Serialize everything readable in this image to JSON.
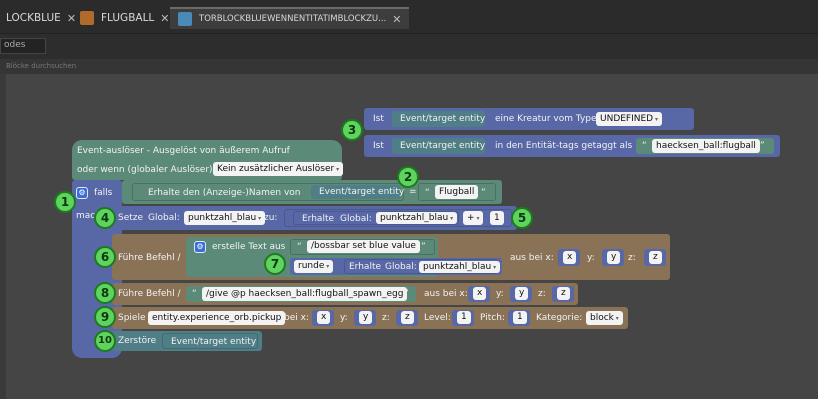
{
  "tabs": [
    {
      "label": "LOCKBLUE",
      "active": false
    },
    {
      "label": "FLUGBALL",
      "active": false
    },
    {
      "label": "TORBLOCKBLUEWENNENTITATIMBLOCKZU...",
      "active": true
    }
  ],
  "tab_close": "✕",
  "mode_field": "odes",
  "search_placeholder": "Blöcke durchsuchen",
  "colors": {
    "trigger": "#5c8a78",
    "teal": "#4f7e86",
    "var": "#5867a5",
    "purple": "#6b5aa8",
    "brown": "#8a7256",
    "green_num": "#5fd35f",
    "text_pill": "#f3f3f3"
  },
  "conditions": {
    "row1": {
      "ist": "Ist",
      "entity": "Event/target entity",
      "text": "eine Kreatur vom Type",
      "type_value": "UNDEFINED"
    },
    "row2": {
      "ist": "Ist",
      "entity": "Event/target entity",
      "text": "in den Entität-tags getaggt als",
      "quote_open": "“",
      "tag": "haecksen_ball:flugball",
      "quote_close": "”"
    }
  },
  "trigger": {
    "line1": "Event-auslöser - Ausgelöst von äußerem Aufruf",
    "line2_prefix": "oder wenn (globaler Auslöser):",
    "global_trigger": "Kein zusätzlicher Auslöser"
  },
  "if_block": {
    "falls": "falls",
    "mache": "mache",
    "get_name": "Erhalte den (Anzeige-)Namen von",
    "entity": "Event/target entity",
    "equals": "=",
    "string": "Flugball"
  },
  "set_block": {
    "setze": "Setze",
    "global_label": "Global:",
    "var_name": "punktzahl_blau",
    "zu": "zu:",
    "erhalte": "Erhalte",
    "erhalte_global": "Global:",
    "erhalte_var": "punktzahl_blau",
    "op": "+",
    "value": "1"
  },
  "cmd1": {
    "label": "Führe Befehl /",
    "create_text": "erstelle Text aus",
    "string1": "/bossbar set blue value",
    "round": "runde",
    "erhalte": "Erhalte",
    "erhalte_global": "Global:",
    "var": "punktzahl_blau",
    "at_x": "aus bei x:",
    "x": "x",
    "y_label": "y:",
    "y": "y",
    "z_label": "z:",
    "z": "z"
  },
  "cmd2": {
    "label": "Führe Befehl /",
    "string": "/give @p haecksen_ball:flugball_spawn_egg",
    "at_x": "aus bei x:",
    "x": "x",
    "y_label": "y:",
    "y": "y",
    "z_label": "z:",
    "z": "z"
  },
  "play": {
    "label": "Spiele",
    "sound": "entity.experience_orb.pickup",
    "at_x": "bei x:",
    "x": "x",
    "y_label": "y:",
    "y": "y",
    "z_label": "z:",
    "z": "z",
    "level_label": "Level:",
    "level": "1",
    "pitch_label": "Pitch:",
    "pitch": "1",
    "kat_label": "Kategorie:",
    "kat": "block"
  },
  "destroy": {
    "label": "Zerstöre",
    "entity": "Event/target entity"
  },
  "markers": [
    "1",
    "2",
    "3",
    "4",
    "5",
    "6",
    "7",
    "8",
    "9",
    "10"
  ],
  "quote_open": "“",
  "quote_close": "”"
}
